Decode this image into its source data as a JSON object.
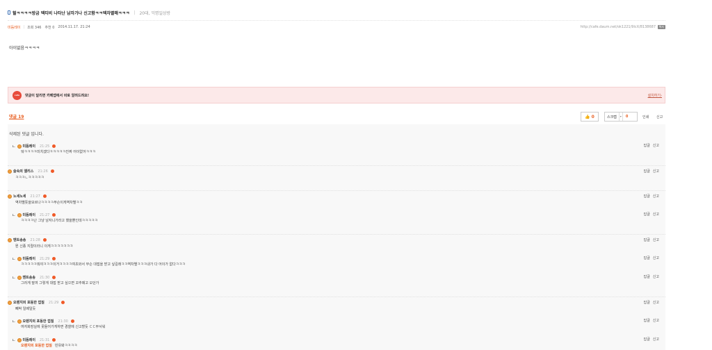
{
  "post": {
    "title": "헐ㅋㅋㅋㅋ방금 엑티비 나타난 남자가나 신고함ㅋㅋ엑차별해ㅋㅋㅋ",
    "board": "20대, 익명일상방",
    "author": "미듬레이",
    "views": "조회 346",
    "recommend": "추천 0",
    "date": "2014.11.17. 21:24",
    "url": "http://cafe.daum.net/ok1221/9lcX/8138687",
    "copy_label": "복사",
    "body": "아이없음ㅋㅋㅋㅋ"
  },
  "banner": {
    "badge": "cafe",
    "text": "댓글이 달리면 카페앱에서 바로 알려드려요!",
    "link": "설치하기›"
  },
  "comments_header": {
    "count_label": "댓글 19",
    "like_count": "0",
    "scrap_label": "스크랩",
    "scrap_arrow": "▾",
    "scrap_count": "0",
    "print_label": "인쇄",
    "report_label": "신고"
  },
  "comments": {
    "deleted_text": "삭제된 댓글 입니다.",
    "reply_label": "답글",
    "report_label": "신고",
    "reply_mark": "ㄴ",
    "items": [
      {
        "nick": "미듬레이",
        "time": "21:25",
        "text": "앜ㅋㅋㅋㅋ미치겠다ㅋㅋㅋㅋㅋ진짜 어이없어ㅋㅋㅋ"
      },
      {
        "nick": "술속의 앨리스",
        "time": "21:26",
        "text": "ㅋㅋㅋㄴㅋㅋㅋㅋㅋ"
      },
      {
        "nick": "노세노세",
        "time": "21:27",
        "text": "역차별뜻을모르나ㅋㅋㅋㅋ무슨이게역차별ㅋㅋ"
      },
      {
        "nick": "미듬레이",
        "time": "21:27",
        "text": "ㅋㅋㅋㅋ난 그냥 남자니가라고 했을뿐인데ㅋㅋㅋㅋㅋ"
      },
      {
        "nick": "멘트송송",
        "time": "21:28",
        "text": "뭔 신종 지랄이라니 이게ㅋㅋㅋㅋㅋㅋㅋ"
      },
      {
        "nick": "미듬레이",
        "time": "21:29",
        "text": "ㅋㅋㅋㅋㅋ뭐야ㅋㅋㅋ이거ㅋㅋㅋㅋ여초와서 무슨 대접을 받고 싶길래ㅋㅋ역차별ㅋㅋㅋ내가 다 어이가 없다ㅋㅋㅋ"
      },
      {
        "nick": "멘트송송",
        "time": "21:30",
        "text": "그러게 말여 그렇게 대접 받고 싶으면 꼬추떼고 오던가"
      },
      {
        "nick": "오렌지의 포동한 껍질",
        "time": "21:29",
        "text": "빼박 일베일듯"
      },
      {
        "nick": "오렌지의 포동한 껍질",
        "time": "21:30",
        "text": "여자화장실에 못들어가게하면 경찰에 신고할듯 ㄷㄷ무서워"
      },
      {
        "nick": "미듬레이",
        "time": "21:31",
        "quote": "오렌지의 포동한 껍질",
        "text": "빈유봐ㅋㅋㅋㅋ"
      }
    ]
  },
  "colors": {
    "accent": "#e85d1f",
    "banner_bg": "#fce9e9",
    "comment_bg": "#f8f8f8"
  }
}
